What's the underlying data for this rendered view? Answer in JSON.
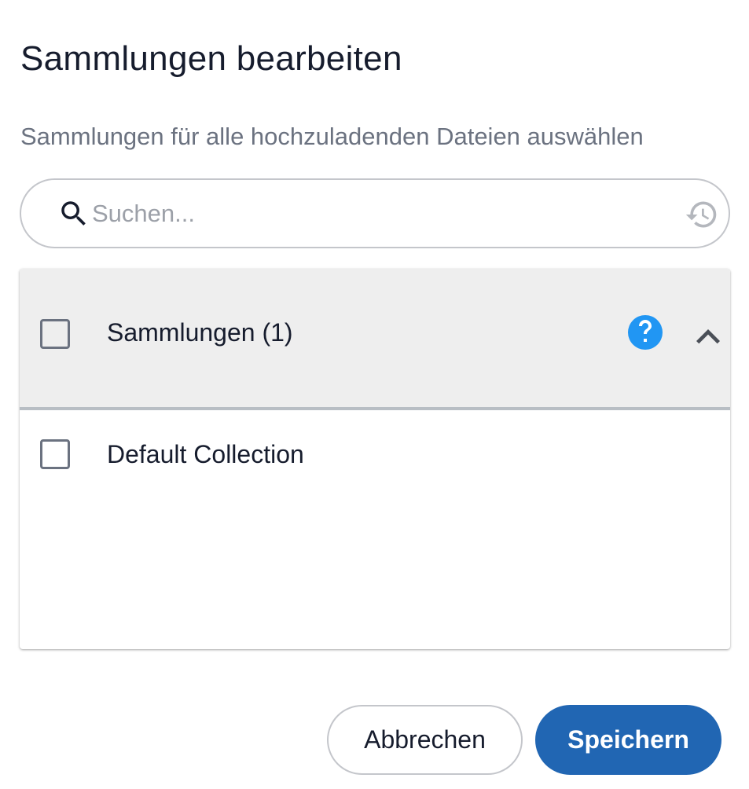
{
  "dialog": {
    "title": "Sammlungen bearbeiten",
    "subtitle": "Sammlungen für alle hochzuladenden Dateien auswählen"
  },
  "search": {
    "placeholder": "Suchen...",
    "value": "",
    "icon": "search-icon",
    "history_icon": "history-icon"
  },
  "collections": {
    "header_label": "Sammlungen (1)",
    "header_checked": false,
    "help_icon": "help-icon",
    "expanded": true,
    "items": [
      {
        "label": "Default Collection",
        "checked": false
      }
    ]
  },
  "actions": {
    "cancel_label": "Abbrechen",
    "save_label": "Speichern"
  },
  "colors": {
    "primary": "#2166b3",
    "help_icon": "#2196f3",
    "header_background": "#eeeeee",
    "subtitle_text": "#6b7280"
  }
}
